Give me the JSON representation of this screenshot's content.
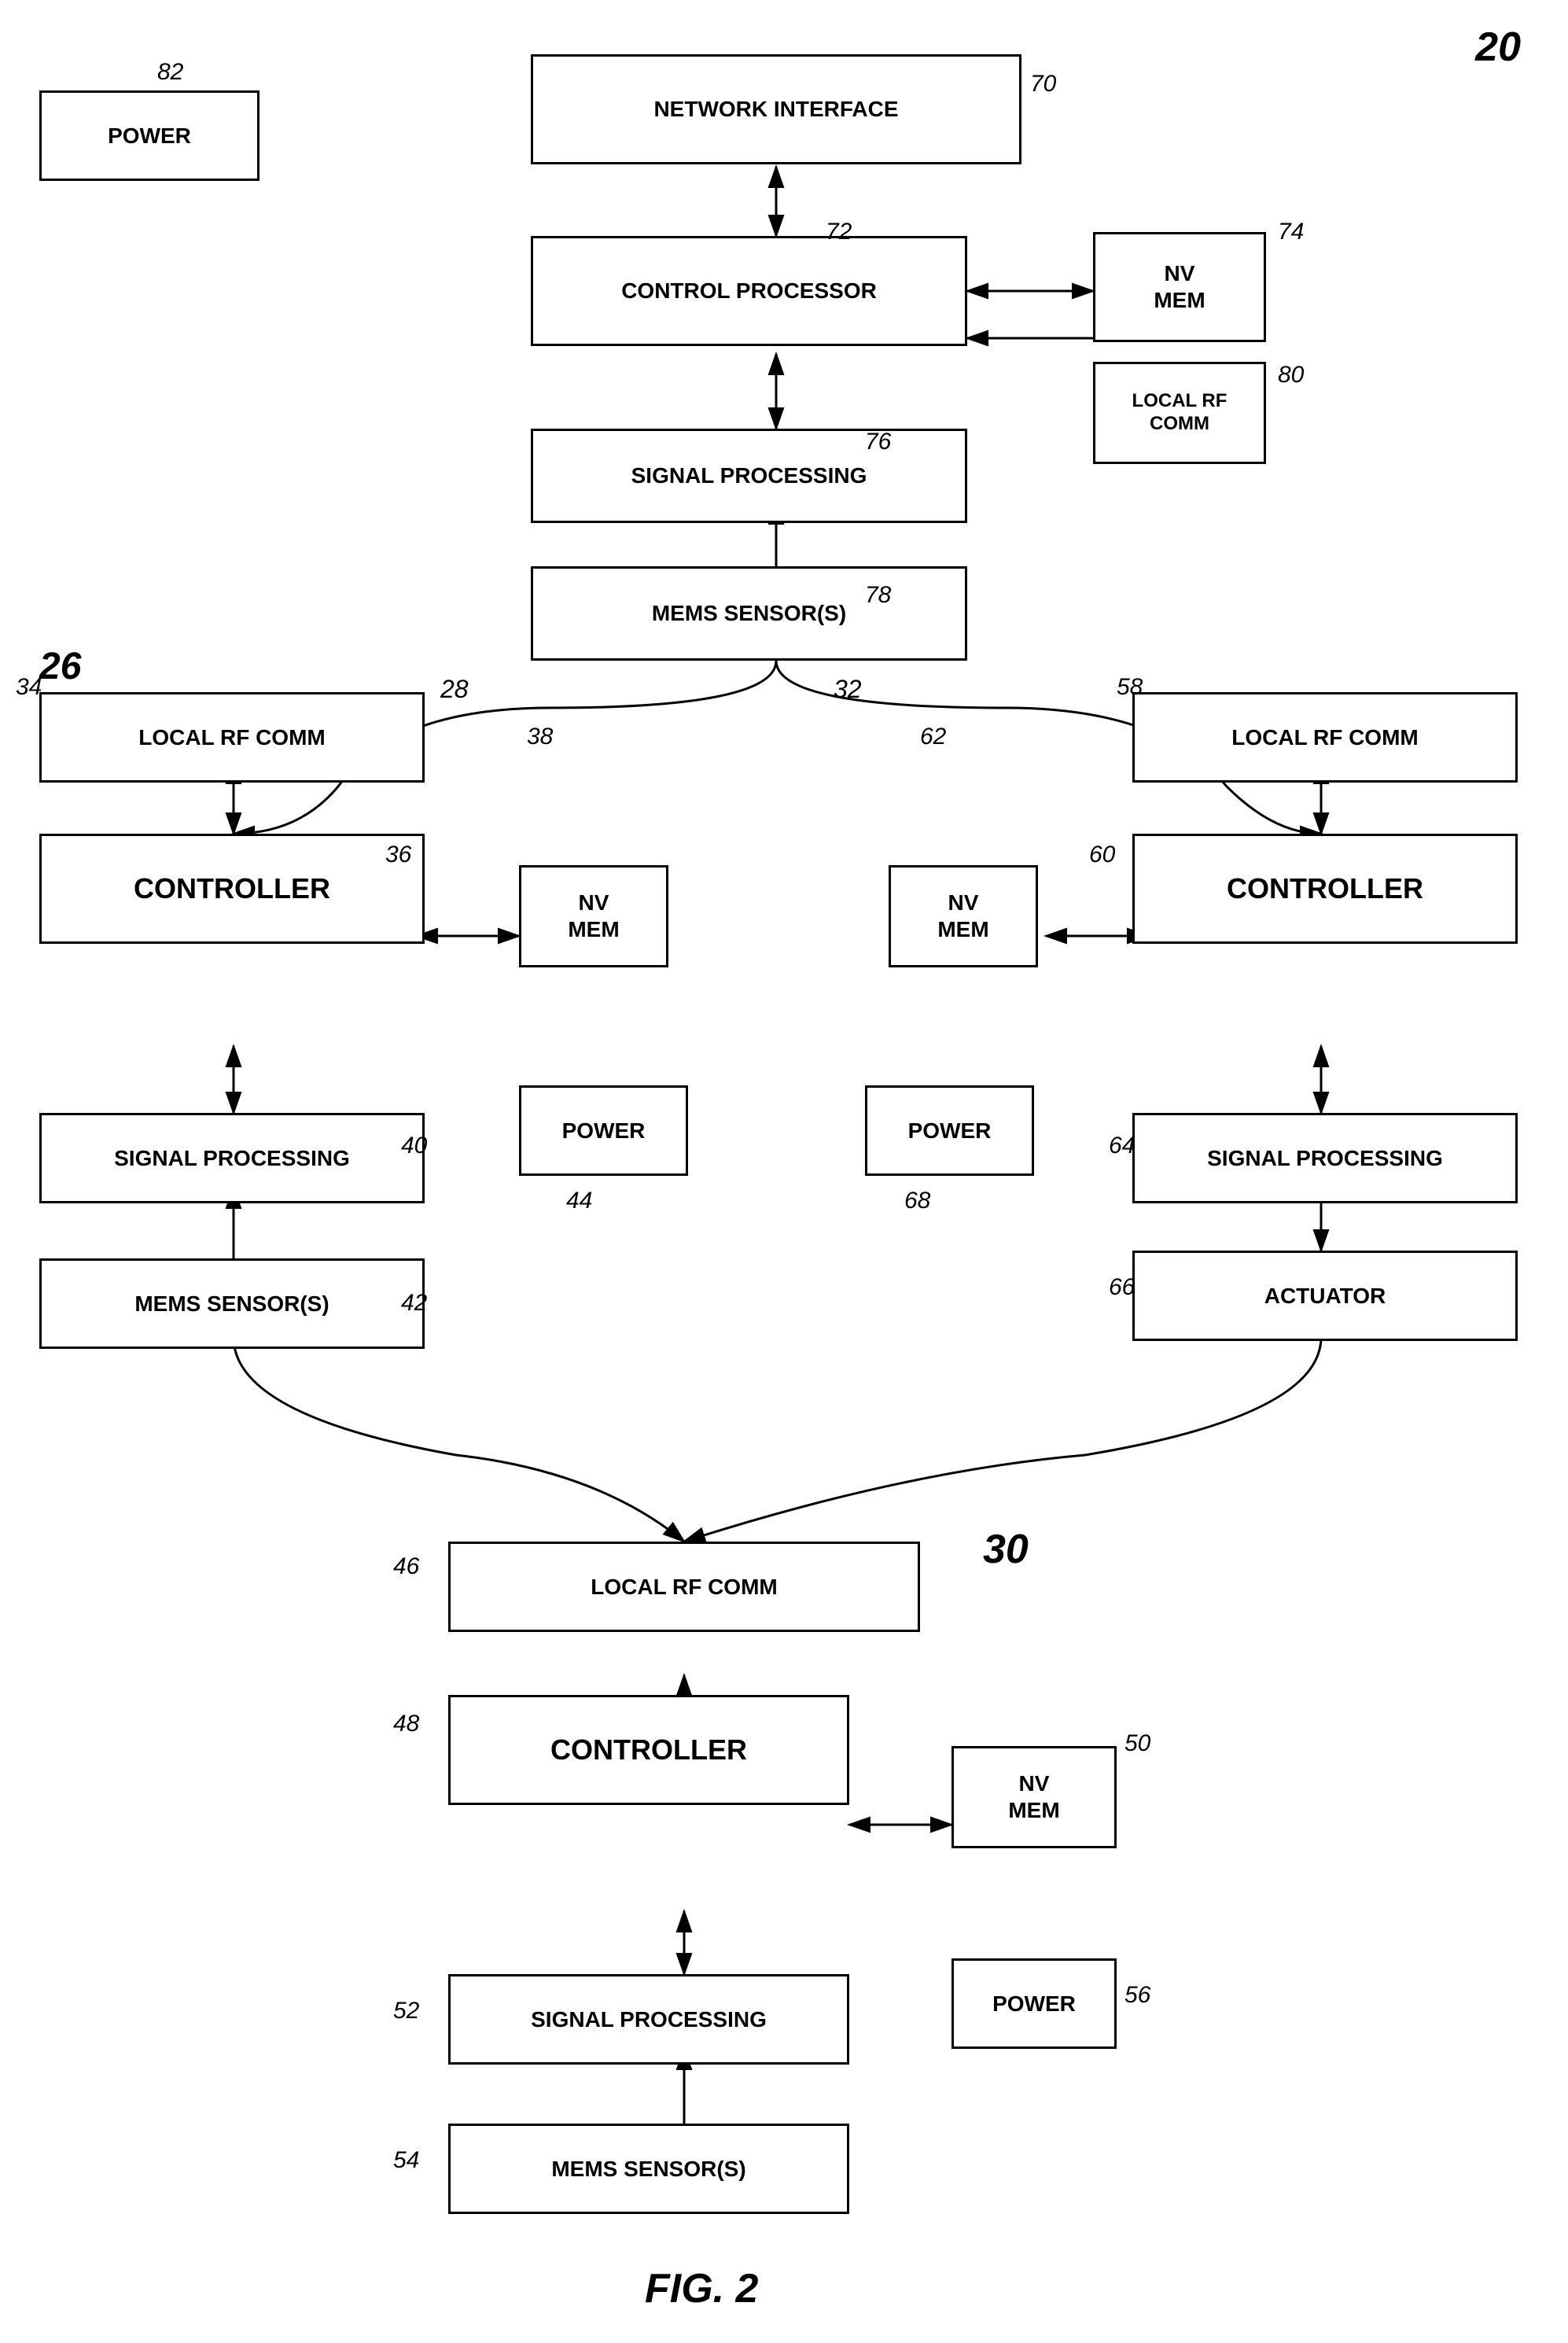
{
  "diagram": {
    "title": "FIG. 2",
    "system_label": "20",
    "nodes": {
      "network_interface": {
        "label": "NETWORK INTERFACE",
        "ref": "70"
      },
      "control_processor": {
        "label": "CONTROL PROCESSOR",
        "ref": "72"
      },
      "nv_mem_top": {
        "label": "NV\nMEM",
        "ref": "74"
      },
      "local_rf_comm_top": {
        "label": "LOCAL RF\nCOMM",
        "ref": "80"
      },
      "signal_processing_top": {
        "label": "SIGNAL PROCESSING",
        "ref": "76"
      },
      "mems_sensor_top": {
        "label": "MEMS SENSOR(S)",
        "ref": "78"
      },
      "power_left_top": {
        "label": "POWER",
        "ref": "82"
      },
      "node26": {
        "label": "26"
      },
      "local_rf_comm_left": {
        "label": "LOCAL RF COMM",
        "ref": "34"
      },
      "controller_left": {
        "label": "CONTROLLER",
        "ref": "36"
      },
      "signal_processing_left": {
        "label": "SIGNAL PROCESSING",
        "ref": "40"
      },
      "mems_sensor_left": {
        "label": "MEMS SENSOR(S)",
        "ref": "42"
      },
      "nv_mem_center_left": {
        "label": "NV\nMEM",
        "ref": "38"
      },
      "nv_mem_center_right": {
        "label": "NV\nMEM",
        "ref": "62"
      },
      "power_center_left": {
        "label": "POWER",
        "ref": "44"
      },
      "power_center_right": {
        "label": "POWER",
        "ref": "68"
      },
      "local_rf_comm_right": {
        "label": "LOCAL RF COMM",
        "ref": "58"
      },
      "controller_right": {
        "label": "CONTROLLER",
        "ref": "60"
      },
      "signal_processing_right": {
        "label": "SIGNAL PROCESSING",
        "ref": "64"
      },
      "actuator_right": {
        "label": "ACTUATOR",
        "ref": "66"
      },
      "node28": {
        "label": "28"
      },
      "node32": {
        "label": "32"
      },
      "local_rf_comm_bottom": {
        "label": "LOCAL RF COMM",
        "ref": "46"
      },
      "controller_bottom": {
        "label": "CONTROLLER",
        "ref": "48"
      },
      "nv_mem_bottom": {
        "label": "NV\nMEM",
        "ref": "50"
      },
      "signal_processing_bottom": {
        "label": "SIGNAL PROCESSING",
        "ref": "52"
      },
      "mems_sensor_bottom": {
        "label": "MEMS SENSOR(S)",
        "ref": "54"
      },
      "power_bottom": {
        "label": "POWER",
        "ref": "56"
      },
      "node30": {
        "label": "30"
      },
      "node48": {
        "label": "48"
      }
    }
  }
}
